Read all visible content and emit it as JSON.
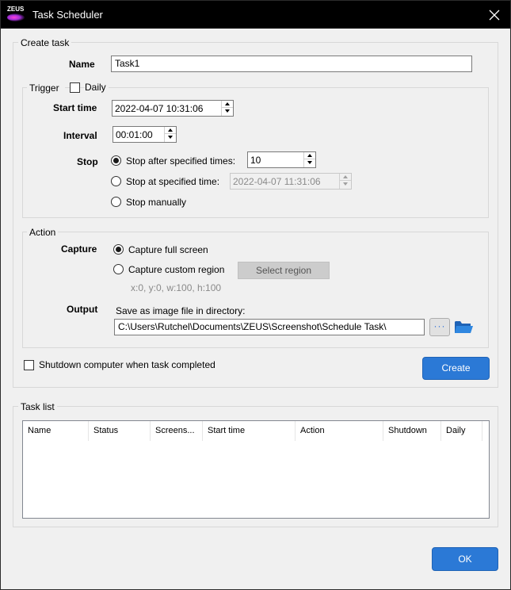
{
  "window": {
    "title": "Task Scheduler",
    "logo_text": "ZEUS"
  },
  "create_task": {
    "legend": "Create task",
    "name_label": "Name",
    "name_value": "Task1",
    "trigger": {
      "legend": "Trigger",
      "daily_label": "Daily",
      "daily_checked": false,
      "start_time_label": "Start time",
      "start_time_value": "2022-04-07 10:31:06",
      "interval_label": "Interval",
      "interval_value": "00:01:00",
      "stop_label": "Stop",
      "stop_options": [
        {
          "label": "Stop after specified times:",
          "checked": true
        },
        {
          "label": "Stop at specified time:",
          "checked": false
        },
        {
          "label": "Stop manually",
          "checked": false
        }
      ],
      "stop_times_value": "10",
      "stop_time_value": "2022-04-07 11:31:06"
    },
    "action": {
      "legend": "Action",
      "capture_label": "Capture",
      "capture_options": [
        {
          "label": "Capture full screen",
          "checked": true
        },
        {
          "label": "Capture custom region",
          "checked": false
        }
      ],
      "select_region_label": "Select region",
      "region_info": "x:0, y:0, w:100, h:100",
      "output_label": "Output",
      "save_label": "Save as image file in directory:",
      "directory_value": "C:\\Users\\Rutchel\\Documents\\ZEUS\\Screenshot\\Schedule Task\\",
      "browse_label": "···"
    },
    "shutdown_label": "Shutdown computer when task completed",
    "shutdown_checked": false,
    "create_button": "Create"
  },
  "task_list": {
    "legend": "Task list",
    "columns": [
      "Name",
      "Status",
      "Screens...",
      "Start time",
      "Action",
      "Shutdown",
      "Daily"
    ],
    "rows": []
  },
  "ok_button": "OK",
  "colors": {
    "accent": "#2b79d6",
    "titlebar": "#000000",
    "background": "#f0f0f0",
    "folder": "#2f7fd1"
  }
}
